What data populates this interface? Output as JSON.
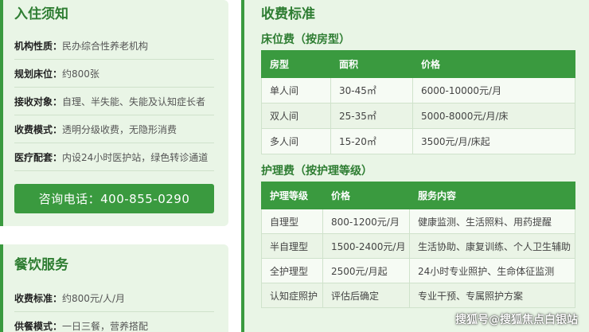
{
  "notice": {
    "title": "入住须知",
    "rows": [
      {
        "key": "机构性质：",
        "value": "民办综合性养老机构"
      },
      {
        "key": "规划床位：",
        "value": "约800张"
      },
      {
        "key": "接收对象：",
        "value": "自理、半失能、失能及认知症长者"
      },
      {
        "key": "收费模式：",
        "value": "透明分级收费，无隐形消费"
      },
      {
        "key": "医疗配套：",
        "value": "内设24小时医护站，绿色转诊通道"
      }
    ],
    "call_button": "咨询电话：400-855-0290"
  },
  "dining": {
    "title": "餐饮服务",
    "rows": [
      {
        "key": "收费标准：",
        "value": "约800元/人/月"
      },
      {
        "key": "供餐模式：",
        "value": "一日三餐，营养搭配"
      }
    ]
  },
  "fees": {
    "title": "收费标准",
    "bed": {
      "subtitle": "床位费（按房型）",
      "headers": [
        "房型",
        "面积",
        "价格"
      ],
      "rows": [
        [
          "单人间",
          "30-45㎡",
          "6000-10000元/月"
        ],
        [
          "双人间",
          "25-35㎡",
          "5000-8000元/月/床"
        ],
        [
          "多人间",
          "15-20㎡",
          "3500元/月/床起"
        ]
      ]
    },
    "care": {
      "subtitle": "护理费（按护理等级）",
      "headers": [
        "护理等级",
        "价格",
        "服务内容"
      ],
      "rows": [
        [
          "自理型",
          "800-1200元/月",
          "健康监测、生活照料、用药提醒"
        ],
        [
          "半自理型",
          "1500-2400元/月",
          "生活协助、康复训练、个人卫生辅助"
        ],
        [
          "全护理型",
          "2500元/月起",
          "24小时专业照护、生命体征监测"
        ],
        [
          "认知症照护",
          "评估后确定",
          "专业干预、专属照护方案"
        ]
      ]
    }
  },
  "watermark": "搜狐号@搜狐焦点白银站",
  "colors": {
    "accent": "#3a9a3f",
    "title_green": "#2e7d32",
    "panel_bg": "#e9f5e6"
  }
}
